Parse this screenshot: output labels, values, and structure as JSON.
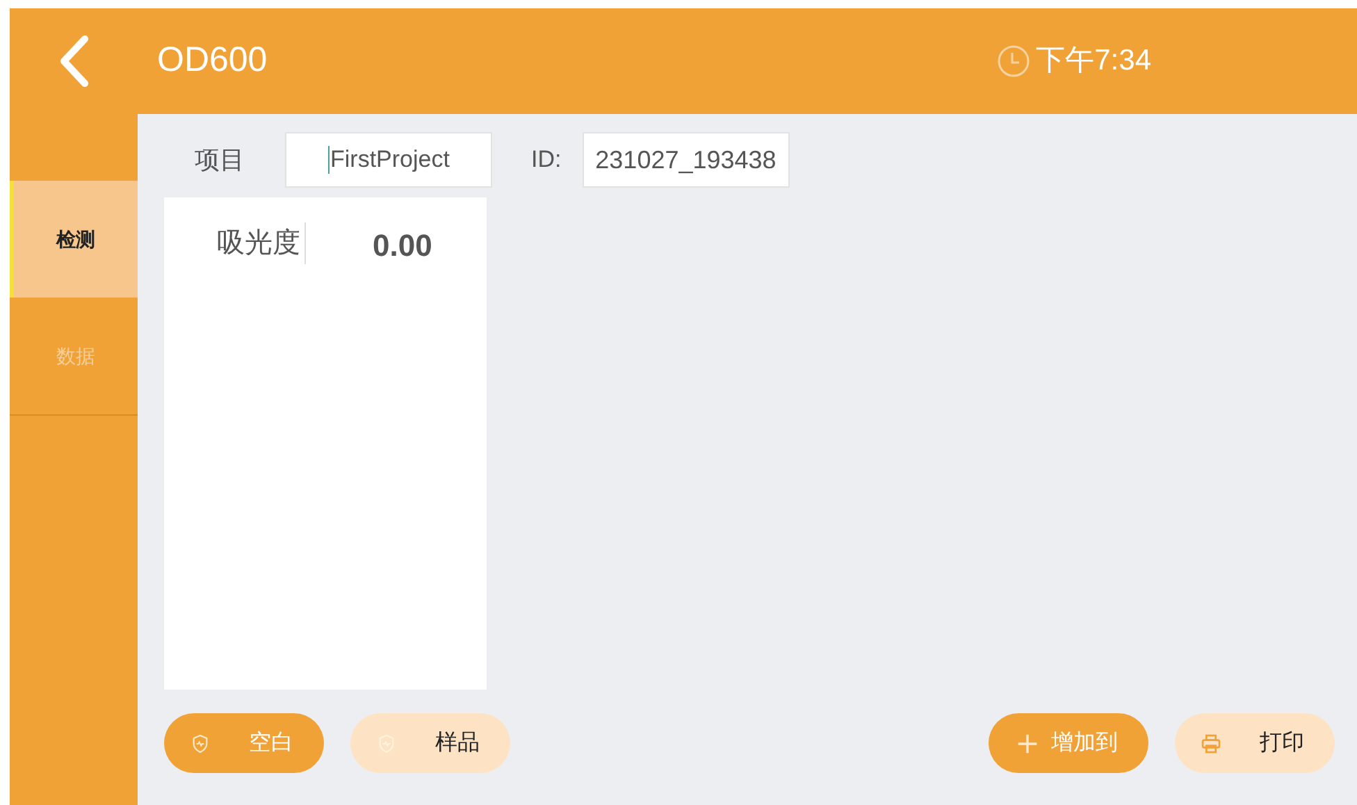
{
  "header": {
    "title": "OD600",
    "time": "下午7:34"
  },
  "sidebar": {
    "items": [
      {
        "label": "检测",
        "selected": true
      },
      {
        "label": "数据",
        "selected": false
      }
    ]
  },
  "form": {
    "project_label": "项目",
    "project_value": "FirstProject",
    "id_label": "ID:",
    "id_value": "231027_193438"
  },
  "reading": {
    "label": "吸光度",
    "value": "0.00"
  },
  "left_buttons": [
    {
      "label": "空白",
      "kind": "filled"
    },
    {
      "label": "样品",
      "kind": "light"
    }
  ],
  "right_buttons": [
    {
      "label": "增加到",
      "kind": "filled"
    },
    {
      "label": "打印",
      "kind": "light"
    }
  ]
}
